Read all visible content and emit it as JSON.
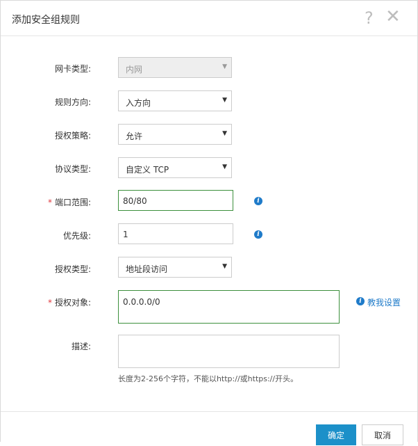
{
  "dialog": {
    "title": "添加安全组规则",
    "help_glyph": "?",
    "close_glyph": "✕"
  },
  "form": {
    "nic_type": {
      "label": "网卡类型:",
      "value": "内网"
    },
    "direction": {
      "label": "规则方向:",
      "value": "入方向"
    },
    "policy": {
      "label": "授权策略:",
      "value": "允许"
    },
    "protocol": {
      "label": "协议类型:",
      "value": "自定义 TCP"
    },
    "port_range": {
      "required": "*",
      "label": "端口范围:",
      "value": "80/80"
    },
    "priority": {
      "label": "优先级:",
      "value": "1"
    },
    "auth_type": {
      "label": "授权类型:",
      "value": "地址段访问"
    },
    "auth_object": {
      "required": "*",
      "label": "授权对象:",
      "value": "0.0.0.0/0",
      "help_link": "教我设置"
    },
    "description": {
      "label": "描述:",
      "value": "",
      "hint": "长度为2-256个字符，不能以http://或https://开头。"
    }
  },
  "buttons": {
    "ok": "确定",
    "cancel": "取消"
  },
  "icons": {
    "info": "i",
    "caret": "▼"
  },
  "colors": {
    "accent": "#1c90c9",
    "focus_border": "#3c8f3c",
    "required": "#e0393e"
  }
}
